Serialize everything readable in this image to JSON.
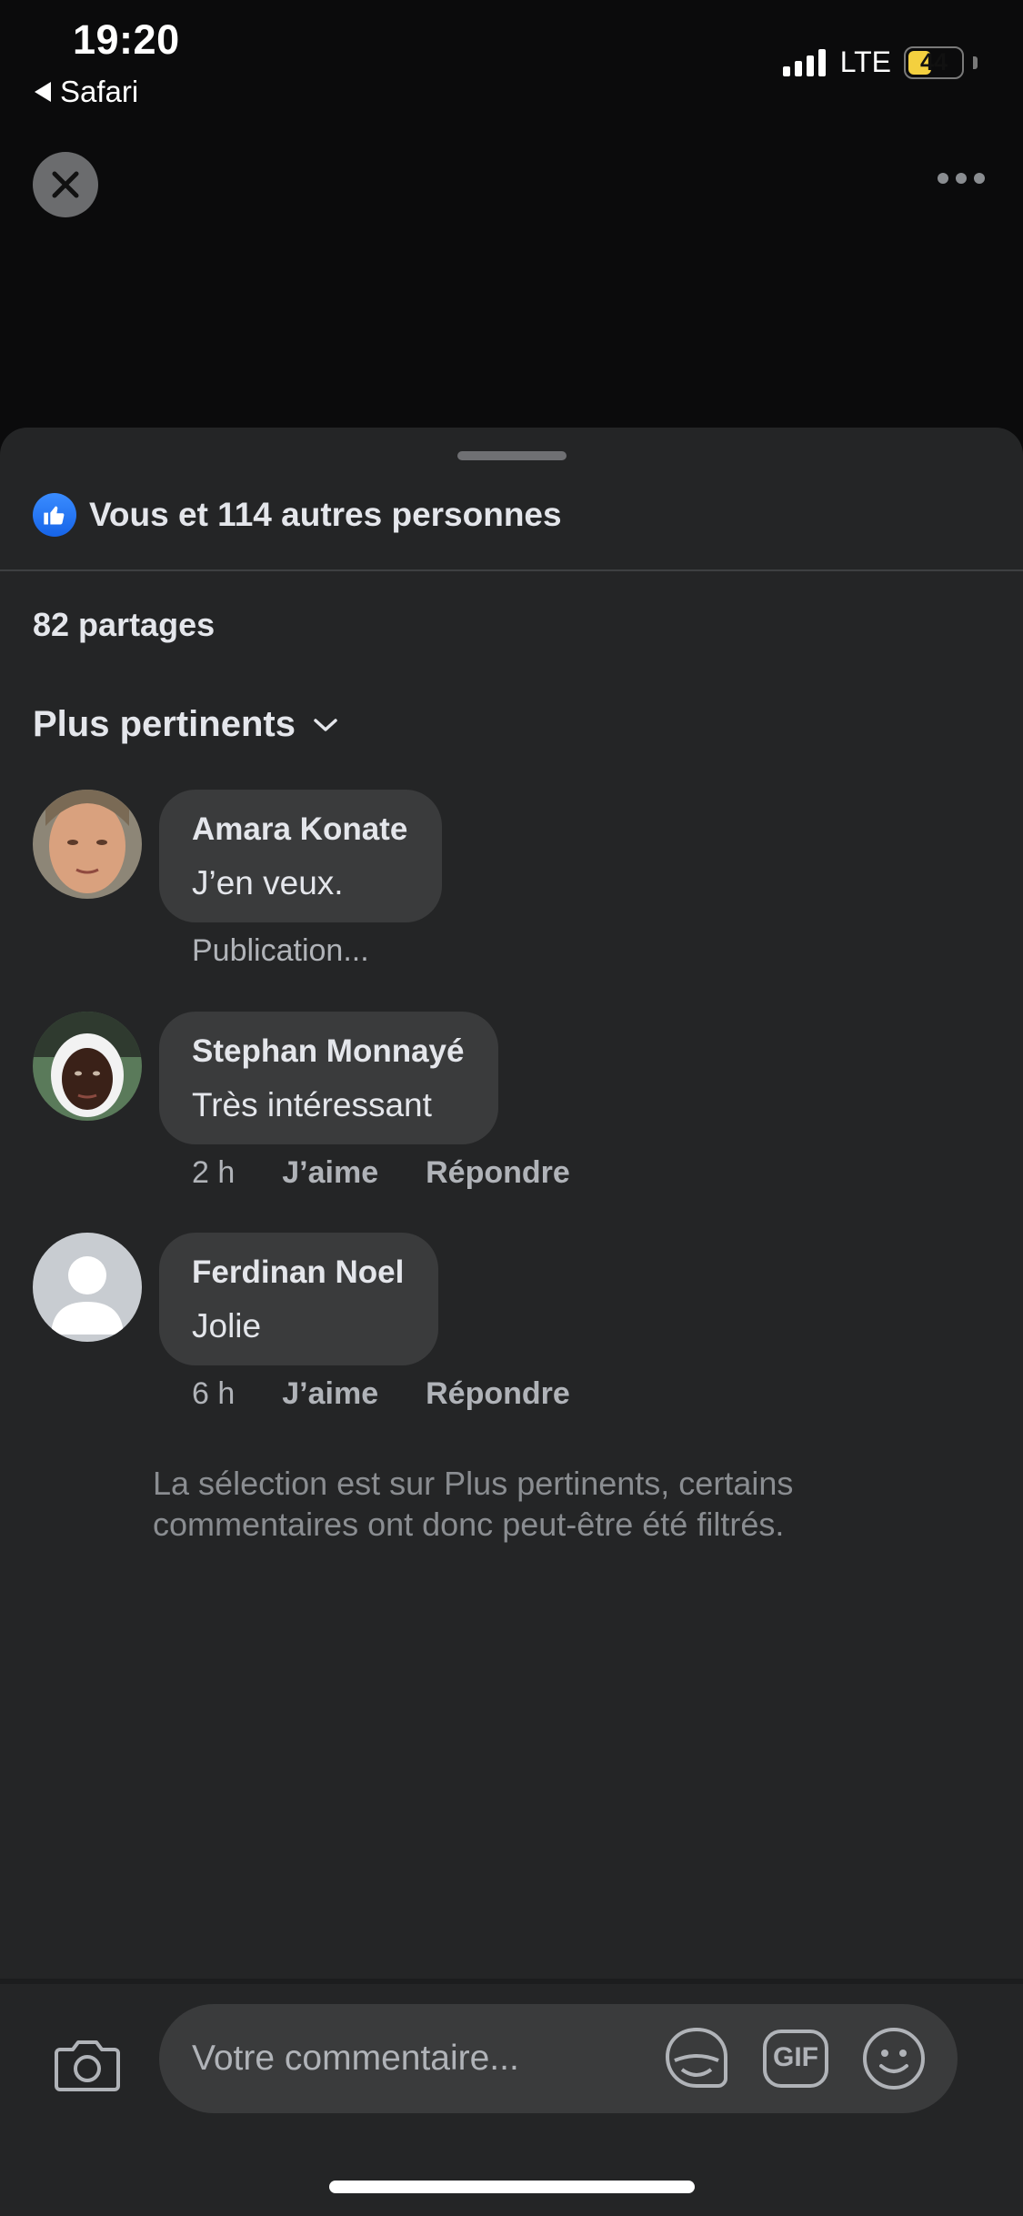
{
  "status_bar": {
    "time": "19:20",
    "back_app": "Safari",
    "network": "LTE",
    "battery": "44",
    "battery_level": 0.44
  },
  "sheet": {
    "reactions_text": "Vous et 114 autres personnes",
    "shares": "82 partages",
    "sort_label": "Plus pertinents",
    "comments": [
      {
        "author": "Amara Konate",
        "text": "J’en veux.",
        "status": "Publication..."
      },
      {
        "author": "Stephan Monnayé",
        "text": "Très intéressant",
        "time": "2 h",
        "like": "J’aime",
        "reply": "Répondre"
      },
      {
        "author": "Ferdinan Noel",
        "text": "Jolie",
        "time": "6 h",
        "like": "J’aime",
        "reply": "Répondre"
      }
    ],
    "filter_note": "La sélection est sur Plus pertinents, certains commentaires ont donc peut-être été filtrés."
  },
  "composer": {
    "placeholder": "Votre commentaire...",
    "gif_label": "GIF"
  },
  "colors": {
    "like_blue": "#1877f2",
    "sheet_bg": "#242526",
    "bubble_bg": "#3a3b3c",
    "battery_yellow": "#f4d03f"
  },
  "icons": [
    "close-icon",
    "more-icon",
    "like-icon",
    "chevron-down-icon",
    "camera-icon",
    "sticker-icon",
    "gif-icon",
    "emoji-icon"
  ]
}
